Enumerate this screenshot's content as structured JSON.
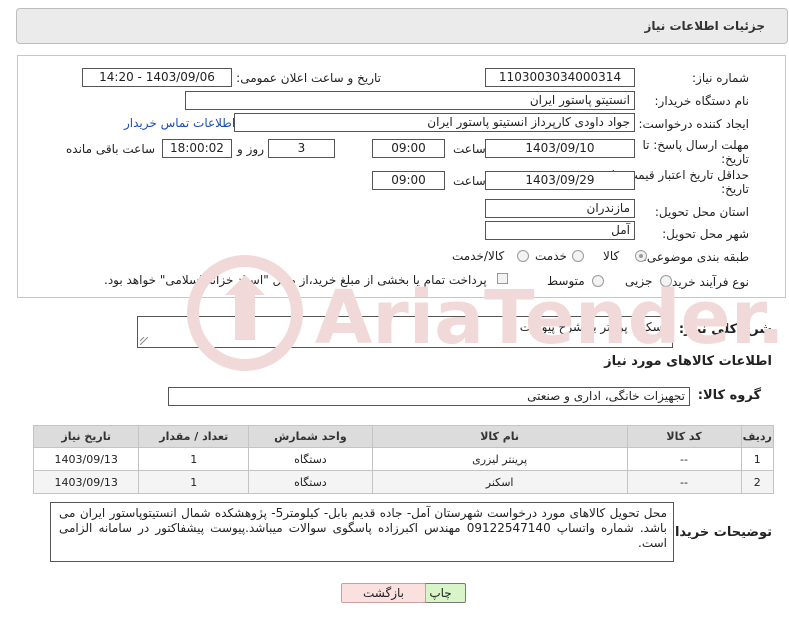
{
  "header": {
    "title": "جزئیات اطلاعات نیاز"
  },
  "form": {
    "need_number_label": "شماره نیاز:",
    "need_number": "1103003034000314",
    "announce_label": "تاریخ و ساعت اعلان عمومی:",
    "announce_value": "1403/09/06 - 14:20",
    "buyer_org_label": "نام دستگاه خریدار:",
    "buyer_org": "انستیتو پاستور ایران",
    "creator_label": "ایجاد کننده درخواست:",
    "creator": "جواد داودی کارپرداز انستیتو پاستور ایران",
    "contact_link": "اطلاعات تماس خریدار",
    "deadline_label_1": "مهلت ارسال پاسخ: تا",
    "deadline_label_2": "تاریخ:",
    "deadline_date": "1403/09/10",
    "time_label": "ساعت",
    "deadline_time": "09:00",
    "days_value": "3",
    "days_label": "روز و",
    "remaining_time": "18:00:02",
    "remaining_label": "ساعت باقی مانده",
    "price_validity_label_1": "حداقل تاریخ اعتبار قیمت: تا",
    "price_validity_label_2": "تاریخ:",
    "price_validity_date": "1403/09/29",
    "price_validity_time": "09:00",
    "province_label": "استان محل تحویل:",
    "province": "مازندران",
    "city_label": "شهر محل تحویل:",
    "city": "آمل",
    "category_label": "طبقه بندی موضوعی:",
    "category_options": [
      "کالا",
      "خدمت",
      "کالا/خدمت"
    ],
    "process_label": "نوع فرآیند خرید :",
    "process_options": [
      "جزیی",
      "متوسط"
    ],
    "payment_note": "پرداخت تمام یا بخشی از مبلغ خرید،از محل \"اسناد خزانه اسلامی\" خواهد بود."
  },
  "description": {
    "label": "شرح کلی نیاز:",
    "value": "اسکنر- پرینتر به شرح پیوست"
  },
  "goods_section_title": "اطلاعات کالاهای مورد نیاز",
  "goods_group": {
    "label": "گروه کالا:",
    "value": "تجهیزات خانگی، اداری و صنعتی"
  },
  "table": {
    "headers": [
      "ردیف",
      "کد کالا",
      "نام کالا",
      "واحد شمارش",
      "تعداد / مقدار",
      "تاریخ نیاز"
    ],
    "rows": [
      [
        "1",
        "--",
        "پرینتر لیزری",
        "دستگاه",
        "1",
        "1403/09/13"
      ],
      [
        "2",
        "--",
        "اسکنر",
        "دستگاه",
        "1",
        "1403/09/13"
      ]
    ]
  },
  "buyer_notes": {
    "label": "توضیحات خریدار:",
    "value": "محل تحویل کالاهای مورد درخواست شهرستان آمل- جاده قدیم بابل- کیلومتر5- پژوهشکده شمال انستیتوپاستور ایران می باشد. شماره واتساپ 09122547140 مهندس اکبرزاده پاسگوی سوالات میباشد.پیوست پیشفاکتور در سامانه الزامی است."
  },
  "buttons": {
    "print": "چاپ",
    "back": "بازگشت"
  },
  "watermark": {
    "text": "AriaTender.net"
  },
  "colors": {
    "link": "#1a4fb5",
    "print_bg": "#d8f5c8",
    "back_bg": "#fbe0e0",
    "header_bg": "#ebebeb",
    "watermark": "#f1d9d9"
  }
}
